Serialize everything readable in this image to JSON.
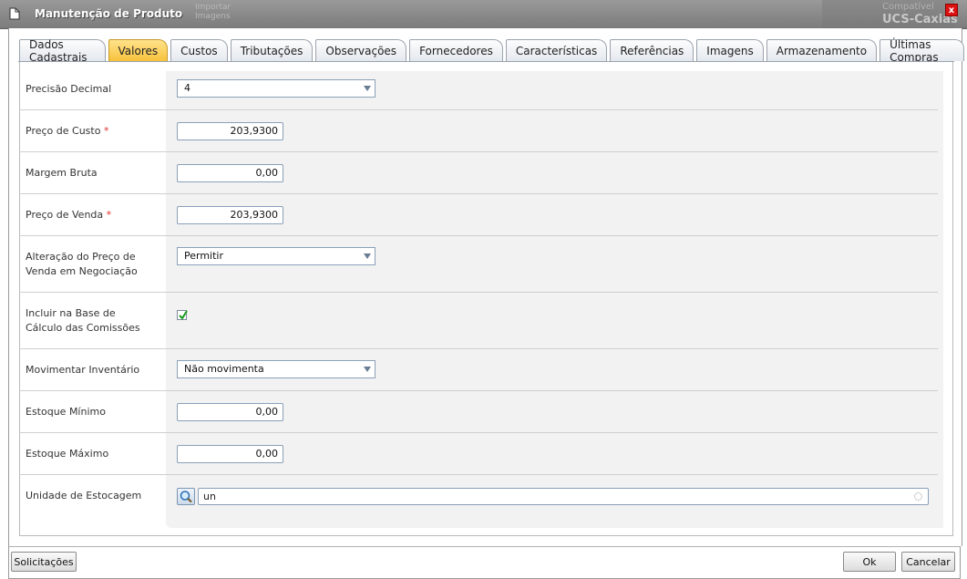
{
  "window": {
    "title": "Manutenção de Produto",
    "ghost_text": [
      "Importar",
      "Imagens"
    ],
    "right_ghost_top": "Compatível",
    "right_ghost_bottom": "UCS-Caxias",
    "close_label": "x"
  },
  "tabs": [
    {
      "label": "Dados Cadastrais",
      "active": false
    },
    {
      "label": "Valores",
      "active": true
    },
    {
      "label": "Custos",
      "active": false
    },
    {
      "label": "Tributações",
      "active": false
    },
    {
      "label": "Observações",
      "active": false
    },
    {
      "label": "Fornecedores",
      "active": false
    },
    {
      "label": "Características",
      "active": false
    },
    {
      "label": "Referências",
      "active": false
    },
    {
      "label": "Imagens",
      "active": false
    },
    {
      "label": "Armazenamento",
      "active": false
    },
    {
      "label": "Últimas Compras",
      "active": false
    }
  ],
  "form": {
    "precisao_decimal": {
      "label": "Precisão Decimal",
      "value": "4"
    },
    "preco_custo": {
      "label": "Preço de Custo",
      "required_mark": "*",
      "value": "203,9300"
    },
    "margem_bruta": {
      "label": "Margem Bruta",
      "value": "0,00"
    },
    "preco_venda": {
      "label": "Preço de Venda",
      "required_mark": "*",
      "value": "203,9300"
    },
    "alteracao_preco": {
      "label_line1": "Alteração do Preço de",
      "label_line2": "Venda em Negociação",
      "value": "Permitir"
    },
    "incluir_base": {
      "label_line1": "Incluir na Base de",
      "label_line2": "Cálculo das Comissões",
      "checked": true
    },
    "movimentar_inventario": {
      "label": "Movimentar Inventário",
      "value": "Não movimenta"
    },
    "estoque_minimo": {
      "label": "Estoque Mínimo",
      "value": "0,00"
    },
    "estoque_maximo": {
      "label": "Estoque Máximo",
      "value": "0,00"
    },
    "unidade_estocagem": {
      "label": "Unidade de Estocagem",
      "value": "un"
    }
  },
  "footer": {
    "solicitacoes_label": "Solicitações",
    "ok_label": "Ok",
    "cancelar_label": "Cancelar"
  }
}
